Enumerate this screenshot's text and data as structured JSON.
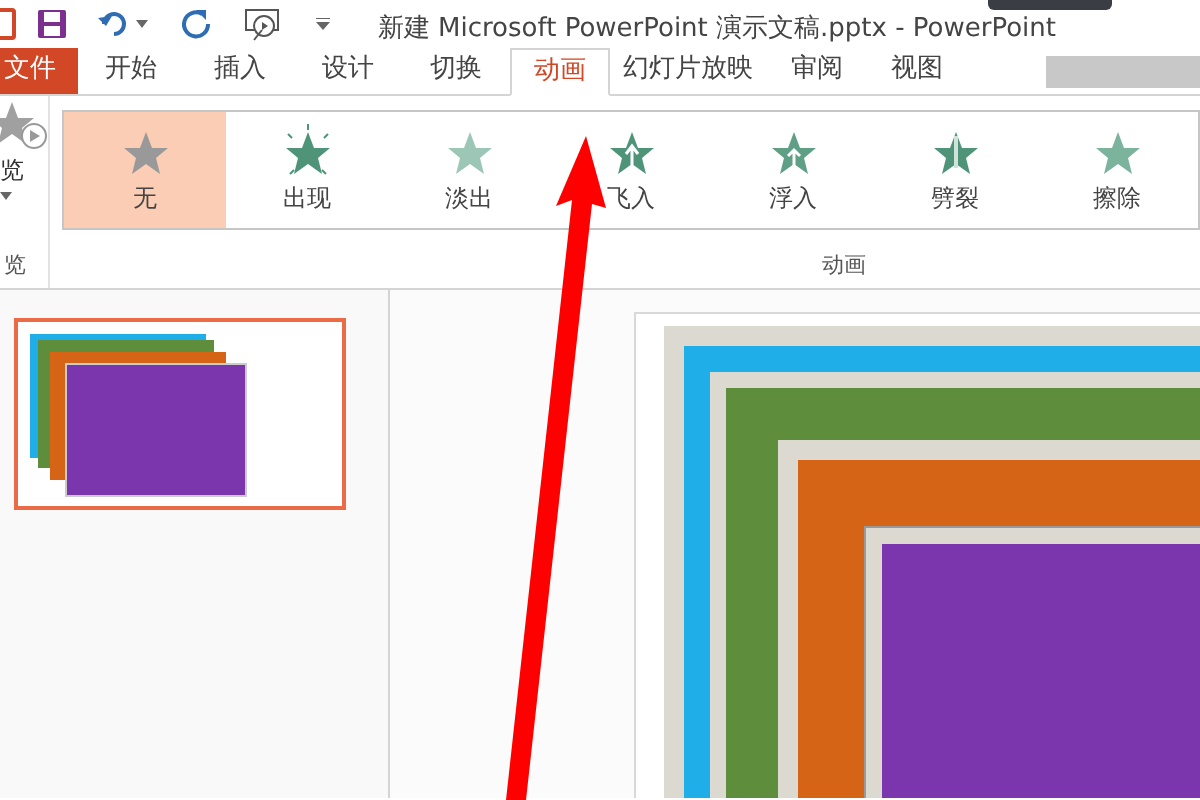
{
  "title_bar": {
    "title": "新建 Microsoft PowerPoint 演示文稿.pptx - PowerPoint"
  },
  "ribbon_tabs": [
    {
      "label": "文件",
      "kind": "file",
      "selected": false
    },
    {
      "label": "开始",
      "kind": "tab",
      "selected": false
    },
    {
      "label": "插入",
      "kind": "tab",
      "selected": false
    },
    {
      "label": "设计",
      "kind": "tab",
      "selected": false
    },
    {
      "label": "切换",
      "kind": "tab",
      "selected": false
    },
    {
      "label": "动画",
      "kind": "tab",
      "selected": true
    },
    {
      "label": "幻灯片放映",
      "kind": "tab",
      "selected": false
    },
    {
      "label": "审阅",
      "kind": "tab",
      "selected": false
    },
    {
      "label": "视图",
      "kind": "tab",
      "selected": false
    }
  ],
  "ribbon": {
    "preview_button": {
      "label": "览"
    },
    "preview_group_label": "览",
    "animations": [
      {
        "label": "无",
        "kind": "none",
        "selected": true
      },
      {
        "label": "出现",
        "kind": "appear",
        "selected": false
      },
      {
        "label": "淡出",
        "kind": "fade",
        "selected": false
      },
      {
        "label": "飞入",
        "kind": "fly",
        "selected": false
      },
      {
        "label": "浮入",
        "kind": "float",
        "selected": false
      },
      {
        "label": "劈裂",
        "kind": "split",
        "selected": false
      },
      {
        "label": "擦除",
        "kind": "wipe",
        "selected": false
      }
    ],
    "animation_group_label": "动画"
  },
  "slides_pane": {
    "thumbnails": [
      {
        "selected": true
      }
    ]
  }
}
